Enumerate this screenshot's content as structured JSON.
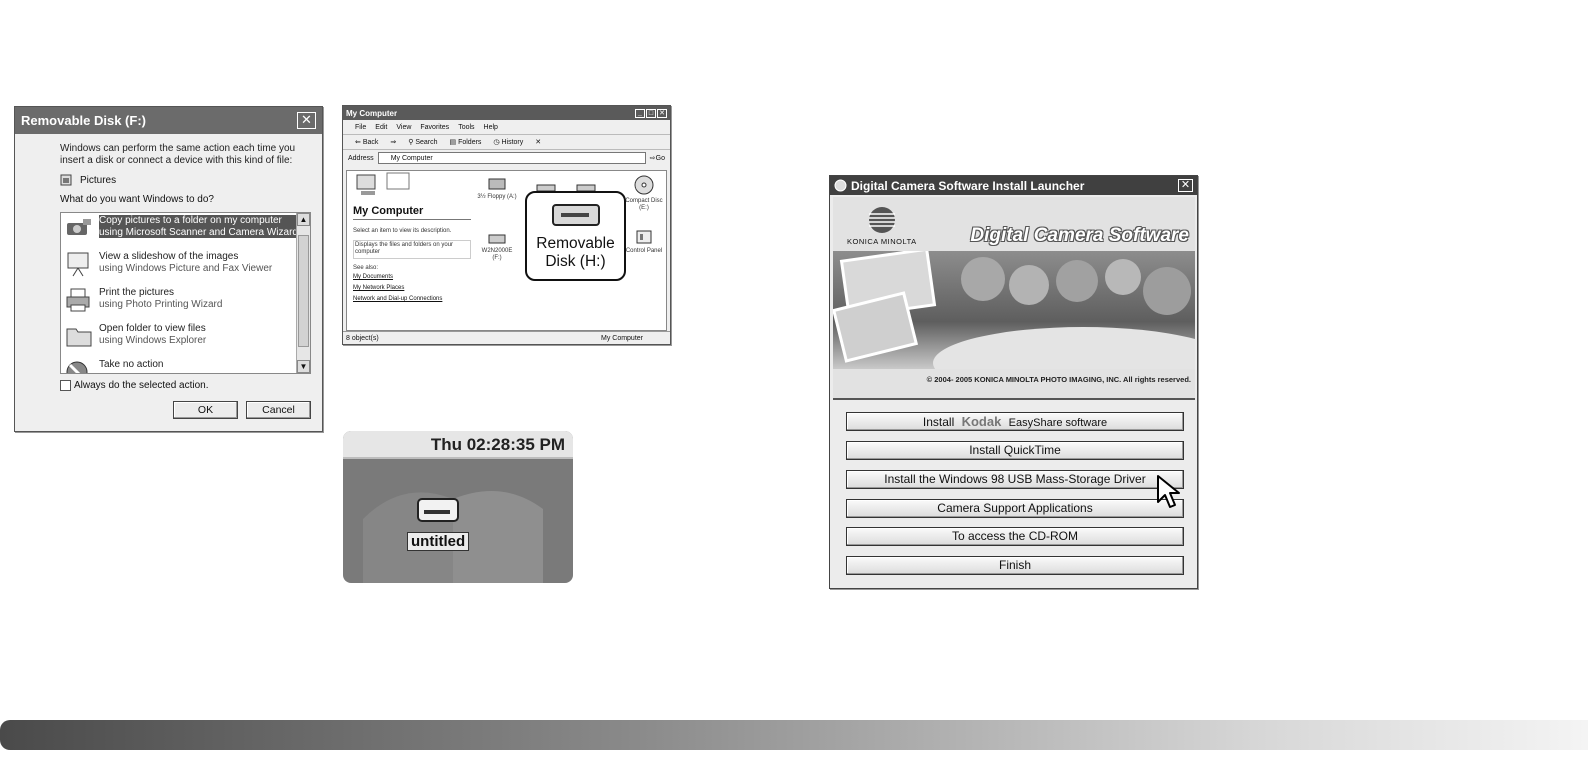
{
  "removable_dialog": {
    "title": "Removable Disk (F:)",
    "message": "Windows can perform the same action each time you insert a disk or connect a device with this kind of file:",
    "content_type": "Pictures",
    "question": "What do you want Windows to do?",
    "actions": [
      {
        "title": "Copy pictures to a folder on my computer",
        "subtitle": "using Microsoft Scanner and Camera Wizard",
        "icon": "camera-icon",
        "selected": true
      },
      {
        "title": "View a slideshow of the images",
        "subtitle": "using Windows Picture and Fax Viewer",
        "icon": "slideshow-icon",
        "selected": false
      },
      {
        "title": "Print the pictures",
        "subtitle": "using Photo Printing Wizard",
        "icon": "printer-icon",
        "selected": false
      },
      {
        "title": "Open folder to view files",
        "subtitle": "using Windows Explorer",
        "icon": "folder-icon",
        "selected": false
      },
      {
        "title": "Take no action",
        "subtitle": "",
        "icon": "no-action-icon",
        "selected": false
      }
    ],
    "always_label": "Always do the selected action.",
    "ok_label": "OK",
    "cancel_label": "Cancel"
  },
  "my_computer": {
    "title": "My Computer",
    "menu": [
      "File",
      "Edit",
      "View",
      "Favorites",
      "Tools",
      "Help"
    ],
    "toolbar": [
      "Back",
      "Search",
      "Folders",
      "History"
    ],
    "address_label": "Address",
    "address_value": "My Computer",
    "go_label": "Go",
    "panel_title": "My Computer",
    "panel_hint": "Select an item to view its description.",
    "panel_hint2": "Displays the files and folders on your computer",
    "see_also": "See also:",
    "links": [
      "My Documents",
      "My Network Places",
      "Network and Dial-up Connections"
    ],
    "drives": [
      {
        "label": "3½ Floppy (A:)"
      },
      {
        "label": "W2N2000E (F:)"
      },
      {
        "label": "Compact Disc (E:)"
      },
      {
        "label": "Control Panel"
      }
    ],
    "highlight_label": "Removable Disk (H:)",
    "status_left": "8 object(s)",
    "status_right": "My Computer"
  },
  "mac_desktop": {
    "clock": "Thu 02:28:35 PM",
    "disk_label": "untitled"
  },
  "launcher": {
    "title": "Digital Camera Software Install Launcher",
    "brand": "KONICA MINOLTA",
    "heading": "Digital Camera Software",
    "copyright": "© 2004- 2005 KONICA MINOLTA PHOTO IMAGING, INC. All rights reserved.",
    "kodak_prefix": "Install",
    "kodak_brand": "Kodak",
    "kodak_suffix": "EasyShare software",
    "buttons": [
      "Install QuickTime",
      "Install the Windows 98 USB Mass-Storage Driver",
      "Camera Support Applications",
      "To access the CD-ROM",
      "Finish"
    ]
  }
}
